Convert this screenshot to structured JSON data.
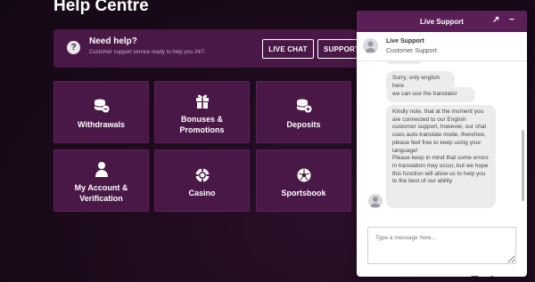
{
  "page": {
    "title": "Help Centre"
  },
  "help_banner": {
    "icon": "question-mark-icon",
    "icon_glyph": "?",
    "title": "Need help?",
    "subtitle": "Customer support service ready to help you 24/7.",
    "live_chat_label": "LIVE CHAT",
    "support_label": "SUPPORT"
  },
  "tiles": [
    {
      "label": "Withdrawals",
      "icon": "coins-minus-icon"
    },
    {
      "label": "Bonuses &\nPromotions",
      "icon": "gift-icon"
    },
    {
      "label": "Deposits",
      "icon": "coins-plus-icon"
    },
    {
      "label": "My Account &\nVerification",
      "icon": "user-icon"
    },
    {
      "label": "Casino",
      "icon": "casino-chip-icon"
    },
    {
      "label": "Sportsbook",
      "icon": "soccer-ball-icon"
    }
  ],
  "chat": {
    "header_title": "Live Support",
    "expand_glyph": "↗",
    "minimize_glyph": "−",
    "agent_name": "Live Support",
    "agent_role": "Customer Support",
    "messages": [
      "Sorry, only english here",
      "we can use the translator",
      "Kindly note, that at the moment you are connected to our English customer support, however, our chat uses auto-translate mode, therefore, please feel free to keep using your language!\nPlease keep in mind that some errors in translation may occur, but we hope this function will allow us to help you to the best of our ability"
    ],
    "input_placeholder": "Type a message here...",
    "tools": [
      "emoji-icon",
      "attachment-icon",
      "more-options-icon"
    ]
  },
  "colors": {
    "background": "#1a0a1a",
    "tile": "#4a1847",
    "chat_header": "#5a1f57",
    "bubble": "#ececec"
  }
}
